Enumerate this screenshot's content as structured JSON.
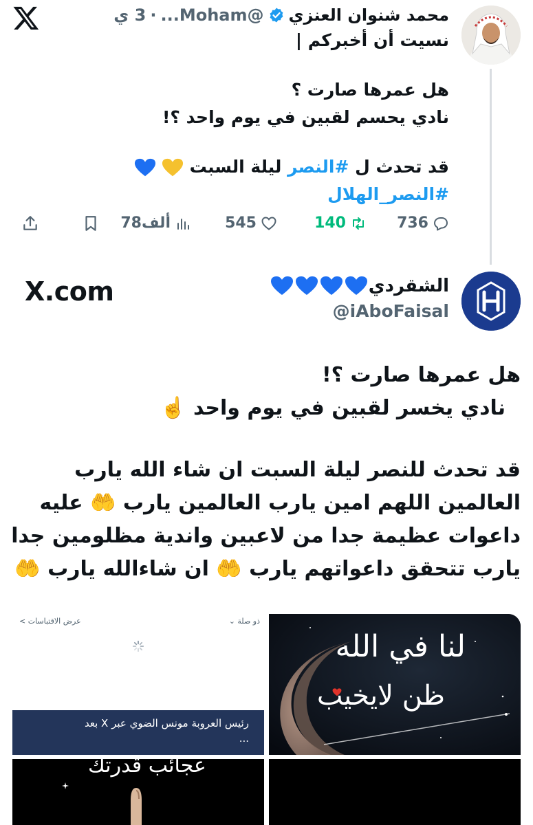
{
  "header": {
    "logo_icon": "x-logo-icon"
  },
  "tweet1": {
    "name": "محمد شنوان العنزي",
    "handle": "@Moham...",
    "time": "3 ي",
    "separator": "·",
    "lines": [
      "نسيت أن أخبركم |",
      "هل عمرها صارت ؟",
      "نادي يحسم لقبين في يوم واحد ؟!",
      "قد تحدث ل",
      "ليلة السبت"
    ],
    "hashtag_inline": "#النصر",
    "hashtag_line": "#النصر_الهلال",
    "emojis": "💙💛",
    "actions": {
      "replies": "736",
      "retweets": "140",
      "likes": "545",
      "views": "78ألف"
    }
  },
  "tweet2": {
    "name": "الشقردي",
    "handle": "@iAboFaisal",
    "watermark": "X.com",
    "lines": [
      "هل عمرها صارت ؟!",
      "نادي يخسر لقبين في يوم واحد ☝️",
      "قد تحدث للنصر ليلة السبت ان شاء الله يارب",
      "العالمين اللهم امين يارب العالمين يارب 🤲 عليه",
      "داعوات عظيمة جدا من لاعبين واندية مظلومين جدا",
      "يارب تتحقق داعواتهم يارب 🤲 ان شاءالله يارب 🤲"
    ]
  },
  "media": {
    "m1_top_right": "ذو صلة ⌄",
    "m1_top_left": "عرض الاقتباسات >",
    "m1_band_line1": "رئيس العروبة مونس الضوي عبر X بعد",
    "m1_band_line2": "...",
    "m2_line1": "لنا في الله",
    "m2_line2": "ظن لايخيب",
    "m3_text": "عجائب قدرتك"
  },
  "colors": {
    "accent": "#1d9bf0",
    "muted": "#536471",
    "retweet": "#00ba7c",
    "heart_blue": "#1d6ff2",
    "heart_yellow": "#f5c12e"
  }
}
